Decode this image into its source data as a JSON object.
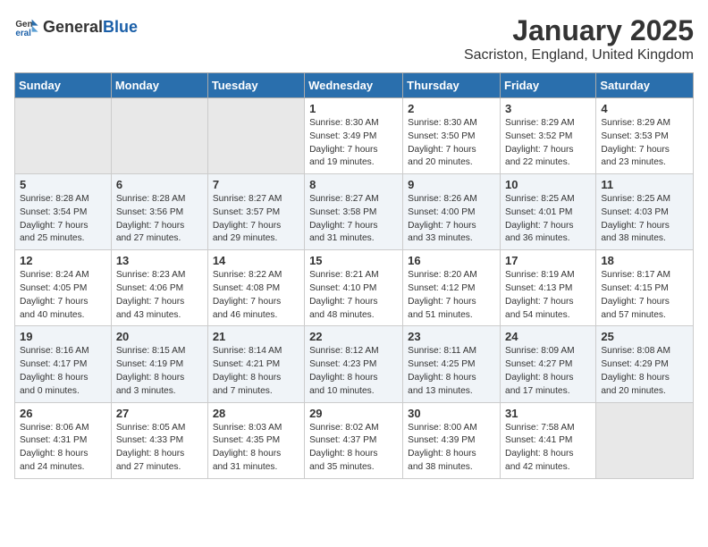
{
  "logo": {
    "general": "General",
    "blue": "Blue"
  },
  "header": {
    "month": "January 2025",
    "location": "Sacriston, England, United Kingdom"
  },
  "weekdays": [
    "Sunday",
    "Monday",
    "Tuesday",
    "Wednesday",
    "Thursday",
    "Friday",
    "Saturday"
  ],
  "weeks": [
    [
      {
        "day": "",
        "content": ""
      },
      {
        "day": "",
        "content": ""
      },
      {
        "day": "",
        "content": ""
      },
      {
        "day": "1",
        "content": "Sunrise: 8:30 AM\nSunset: 3:49 PM\nDaylight: 7 hours\nand 19 minutes."
      },
      {
        "day": "2",
        "content": "Sunrise: 8:30 AM\nSunset: 3:50 PM\nDaylight: 7 hours\nand 20 minutes."
      },
      {
        "day": "3",
        "content": "Sunrise: 8:29 AM\nSunset: 3:52 PM\nDaylight: 7 hours\nand 22 minutes."
      },
      {
        "day": "4",
        "content": "Sunrise: 8:29 AM\nSunset: 3:53 PM\nDaylight: 7 hours\nand 23 minutes."
      }
    ],
    [
      {
        "day": "5",
        "content": "Sunrise: 8:28 AM\nSunset: 3:54 PM\nDaylight: 7 hours\nand 25 minutes."
      },
      {
        "day": "6",
        "content": "Sunrise: 8:28 AM\nSunset: 3:56 PM\nDaylight: 7 hours\nand 27 minutes."
      },
      {
        "day": "7",
        "content": "Sunrise: 8:27 AM\nSunset: 3:57 PM\nDaylight: 7 hours\nand 29 minutes."
      },
      {
        "day": "8",
        "content": "Sunrise: 8:27 AM\nSunset: 3:58 PM\nDaylight: 7 hours\nand 31 minutes."
      },
      {
        "day": "9",
        "content": "Sunrise: 8:26 AM\nSunset: 4:00 PM\nDaylight: 7 hours\nand 33 minutes."
      },
      {
        "day": "10",
        "content": "Sunrise: 8:25 AM\nSunset: 4:01 PM\nDaylight: 7 hours\nand 36 minutes."
      },
      {
        "day": "11",
        "content": "Sunrise: 8:25 AM\nSunset: 4:03 PM\nDaylight: 7 hours\nand 38 minutes."
      }
    ],
    [
      {
        "day": "12",
        "content": "Sunrise: 8:24 AM\nSunset: 4:05 PM\nDaylight: 7 hours\nand 40 minutes."
      },
      {
        "day": "13",
        "content": "Sunrise: 8:23 AM\nSunset: 4:06 PM\nDaylight: 7 hours\nand 43 minutes."
      },
      {
        "day": "14",
        "content": "Sunrise: 8:22 AM\nSunset: 4:08 PM\nDaylight: 7 hours\nand 46 minutes."
      },
      {
        "day": "15",
        "content": "Sunrise: 8:21 AM\nSunset: 4:10 PM\nDaylight: 7 hours\nand 48 minutes."
      },
      {
        "day": "16",
        "content": "Sunrise: 8:20 AM\nSunset: 4:12 PM\nDaylight: 7 hours\nand 51 minutes."
      },
      {
        "day": "17",
        "content": "Sunrise: 8:19 AM\nSunset: 4:13 PM\nDaylight: 7 hours\nand 54 minutes."
      },
      {
        "day": "18",
        "content": "Sunrise: 8:17 AM\nSunset: 4:15 PM\nDaylight: 7 hours\nand 57 minutes."
      }
    ],
    [
      {
        "day": "19",
        "content": "Sunrise: 8:16 AM\nSunset: 4:17 PM\nDaylight: 8 hours\nand 0 minutes."
      },
      {
        "day": "20",
        "content": "Sunrise: 8:15 AM\nSunset: 4:19 PM\nDaylight: 8 hours\nand 3 minutes."
      },
      {
        "day": "21",
        "content": "Sunrise: 8:14 AM\nSunset: 4:21 PM\nDaylight: 8 hours\nand 7 minutes."
      },
      {
        "day": "22",
        "content": "Sunrise: 8:12 AM\nSunset: 4:23 PM\nDaylight: 8 hours\nand 10 minutes."
      },
      {
        "day": "23",
        "content": "Sunrise: 8:11 AM\nSunset: 4:25 PM\nDaylight: 8 hours\nand 13 minutes."
      },
      {
        "day": "24",
        "content": "Sunrise: 8:09 AM\nSunset: 4:27 PM\nDaylight: 8 hours\nand 17 minutes."
      },
      {
        "day": "25",
        "content": "Sunrise: 8:08 AM\nSunset: 4:29 PM\nDaylight: 8 hours\nand 20 minutes."
      }
    ],
    [
      {
        "day": "26",
        "content": "Sunrise: 8:06 AM\nSunset: 4:31 PM\nDaylight: 8 hours\nand 24 minutes."
      },
      {
        "day": "27",
        "content": "Sunrise: 8:05 AM\nSunset: 4:33 PM\nDaylight: 8 hours\nand 27 minutes."
      },
      {
        "day": "28",
        "content": "Sunrise: 8:03 AM\nSunset: 4:35 PM\nDaylight: 8 hours\nand 31 minutes."
      },
      {
        "day": "29",
        "content": "Sunrise: 8:02 AM\nSunset: 4:37 PM\nDaylight: 8 hours\nand 35 minutes."
      },
      {
        "day": "30",
        "content": "Sunrise: 8:00 AM\nSunset: 4:39 PM\nDaylight: 8 hours\nand 38 minutes."
      },
      {
        "day": "31",
        "content": "Sunrise: 7:58 AM\nSunset: 4:41 PM\nDaylight: 8 hours\nand 42 minutes."
      },
      {
        "day": "",
        "content": ""
      }
    ]
  ]
}
